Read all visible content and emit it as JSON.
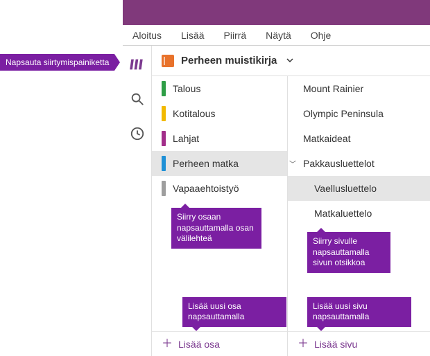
{
  "callouts": {
    "nav_button": "Napsauta siirtymispainiketta",
    "section_tip": "Siirry osaan napsauttamalla osan välilehteä",
    "page_tip": "Siirry sivulle napsauttamalla sivun otsikkoa",
    "add_section_tip": "Lisää uusi osa napsauttamalla",
    "add_page_tip": "Lisää uusi sivu napsauttamalla"
  },
  "menu": {
    "home": "Aloitus",
    "insert": "Lisää",
    "draw": "Piirrä",
    "view": "Näytä",
    "help": "Ohje"
  },
  "notebook": {
    "title": "Perheen muistikirja"
  },
  "sections": [
    {
      "label": "Talous",
      "color": "#2e9e46"
    },
    {
      "label": "Kotitalous",
      "color": "#f2b900"
    },
    {
      "label": "Lahjat",
      "color": "#a22e8a"
    },
    {
      "label": "Perheen matka",
      "color": "#1e90d6",
      "selected": true
    },
    {
      "label": "Vapaaehtoistyö",
      "color": "#9e9e9e"
    }
  ],
  "pages": [
    {
      "label": "Mount Rainier"
    },
    {
      "label": "Olympic Peninsula"
    },
    {
      "label": "Matkaideat"
    },
    {
      "label": "Pakkausluettelot",
      "expandable": true
    },
    {
      "label": "Vaellusluettelo",
      "indent": true,
      "selected": true
    },
    {
      "label": "Matkaluettelo",
      "indent": true
    }
  ],
  "actions": {
    "add_section": "Lisää osa",
    "add_page": "Lisää sivu"
  }
}
